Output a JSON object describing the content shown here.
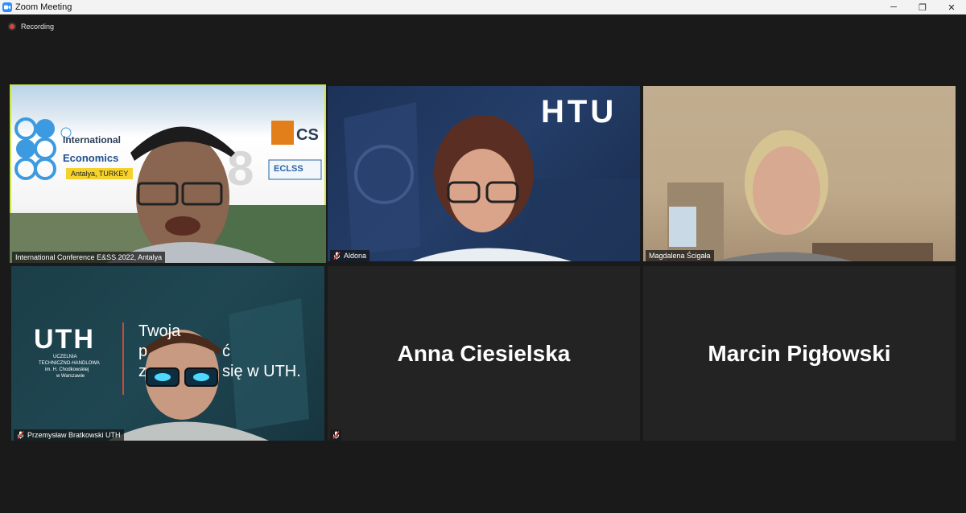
{
  "window": {
    "title": "Zoom Meeting",
    "minimize_glyph": "─",
    "restore_glyph": "❐",
    "close_glyph": "✕"
  },
  "recording": {
    "label": "Recording"
  },
  "participants": [
    {
      "name": "International Conference E&SS 2022, Antalya",
      "muted": false,
      "video": true,
      "active_speaker": true,
      "banner": {
        "line1": "International",
        "line2": "Economics",
        "line3": "Antalya, TURKEY",
        "badge": "CS",
        "badge2": "ECLSS"
      }
    },
    {
      "name": "Aldona",
      "muted": true,
      "video": true,
      "banner": {
        "logo": "HTU"
      }
    },
    {
      "name": "Magdalena Ścigała",
      "muted": false,
      "video": true
    },
    {
      "name": "Przemysław Bratkowski UTH",
      "muted": true,
      "video": true,
      "banner": {
        "logo": "UTH",
        "sub1": "UCZELNIA",
        "sub2": "TECHNICZNO-HANDLOWA",
        "sub3": "im. H. Chodkowskiej",
        "sub4": "w Warszawie",
        "slogan1": "Twoja",
        "slogan2": "p",
        "slogan3": "ć",
        "slogan4": "z",
        "slogan5": "się w UTH."
      }
    },
    {
      "name": "Anna Ciesielska",
      "muted": true,
      "video": false
    },
    {
      "name": "Marcin Pigłowski",
      "muted": false,
      "video": false
    }
  ]
}
